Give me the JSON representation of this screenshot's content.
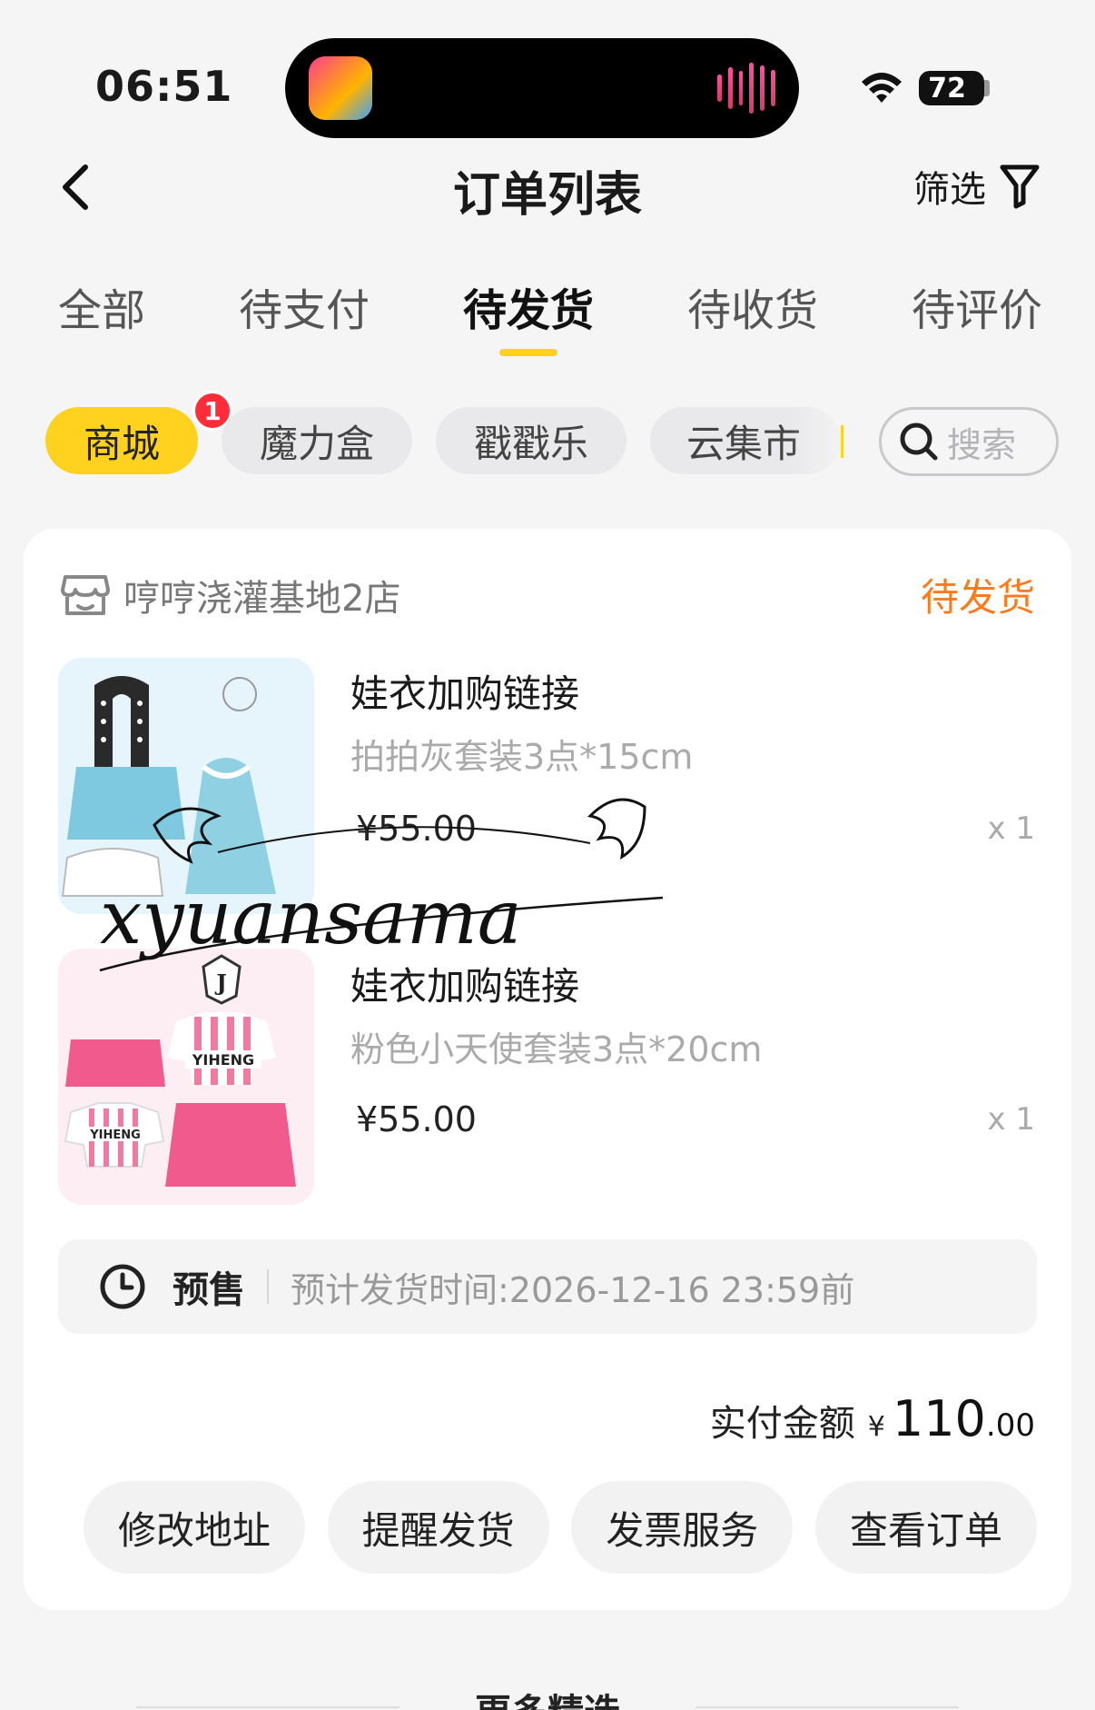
{
  "status_bar": {
    "time": "06:51",
    "battery": "72"
  },
  "nav": {
    "title": "订单列表",
    "filter_label": "筛选"
  },
  "tabs": [
    {
      "label": "全部"
    },
    {
      "label": "待支付"
    },
    {
      "label": "待发货",
      "active": true
    },
    {
      "label": "待收货"
    },
    {
      "label": "待评价"
    }
  ],
  "categories": [
    {
      "label": "商城",
      "active": true,
      "badge": "1"
    },
    {
      "label": "魔力盒"
    },
    {
      "label": "戳戳乐"
    },
    {
      "label": "云集市"
    }
  ],
  "search": {
    "placeholder": "搜索"
  },
  "order": {
    "shop_name": "哼哼浇灌基地2店",
    "status": "待发货",
    "items": [
      {
        "title": "娃衣加购链接",
        "spec": "拍拍灰套装3点*15cm",
        "price": "¥55.00",
        "qty": "x 1"
      },
      {
        "title": "娃衣加购链接",
        "spec": "粉色小天使套装3点*20cm",
        "price": "¥55.00",
        "qty": "x 1"
      }
    ],
    "presale": {
      "label": "预售",
      "ship_time": "预计发货时间:2026-12-16 23:59前"
    },
    "total": {
      "label": "实付金额",
      "currency": "¥",
      "integer": "110",
      "decimal": ".00"
    },
    "actions": [
      {
        "label": "修改地址"
      },
      {
        "label": "提醒发货"
      },
      {
        "label": "发票服务"
      },
      {
        "label": "查看订单"
      }
    ]
  },
  "more": {
    "title": "更多精选"
  },
  "thumbnail_text": {
    "brand": "YIHENG",
    "logo_letter": "J"
  },
  "watermark": {
    "text": "xyuansama"
  },
  "colors": {
    "accent": "#ffd21f",
    "status_orange": "#ff7a1a",
    "badge_red": "#ff2d3a"
  }
}
